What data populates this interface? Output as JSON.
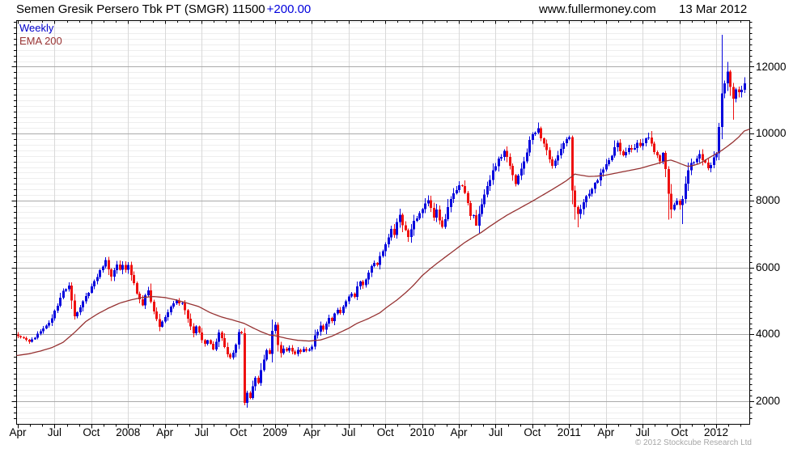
{
  "header": {
    "instrument": "Semen Gresik Persero Tbk PT (SMGR)",
    "last_price": "11500",
    "change": "+200.00",
    "website": "www.fullermoney.com",
    "date": "13 Mar 2012"
  },
  "legend": {
    "timeframe": "Weekly",
    "overlay": "EMA 200"
  },
  "footer": {
    "copyright": "© 2012 Stockcube Research Ltd"
  },
  "colors": {
    "up": "#0707dd",
    "down": "#ee1111",
    "ema": "#963232",
    "timeframe_label": "#0000cc",
    "overlay_label": "#993333",
    "change_text": "#0000dd",
    "grid_minor": "#eeeeee",
    "grid_vertical": "#d9d9d9",
    "grid_major": "#aaaaaa",
    "axis": "#000000",
    "copyright_text": "#a6a6a6"
  },
  "y_axis": {
    "ticks": [
      2000,
      4000,
      6000,
      8000,
      10000,
      12000
    ]
  },
  "x_axis": {
    "ticks": [
      "Apr",
      "Jul",
      "Oct",
      "2008",
      "Apr",
      "Jul",
      "Oct",
      "2009",
      "Apr",
      "Jul",
      "Oct",
      "2010",
      "Apr",
      "Jul",
      "Oct",
      "2011",
      "Apr",
      "Jul",
      "Oct",
      "2012"
    ]
  },
  "chart_data": {
    "type": "candlestick",
    "title": "Semen Gresik Persero Tbk PT (SMGR) weekly candlestick chart with 200-period EMA",
    "x_range": "Apr 2007 - Mar 2012",
    "x_unit": "week",
    "weeks": 258,
    "ylim_visible": [
      1320,
      13400
    ],
    "grid": "on",
    "up_rule": "close >= open",
    "close_anchors": [
      [
        0,
        3950
      ],
      [
        2,
        3870
      ],
      [
        4,
        3800
      ],
      [
        6,
        3900
      ],
      [
        8,
        4100
      ],
      [
        10,
        4250
      ],
      [
        12,
        4500
      ],
      [
        14,
        4850
      ],
      [
        16,
        5300
      ],
      [
        18,
        5450
      ],
      [
        19,
        5000
      ],
      [
        20,
        4500
      ],
      [
        21,
        4650
      ],
      [
        23,
        5000
      ],
      [
        25,
        5250
      ],
      [
        26,
        5450
      ],
      [
        28,
        5750
      ],
      [
        30,
        6050
      ],
      [
        31,
        6200
      ],
      [
        32,
        5950
      ],
      [
        33,
        5750
      ],
      [
        34,
        5950
      ],
      [
        35,
        6100
      ],
      [
        36,
        5900
      ],
      [
        37,
        6050
      ],
      [
        38,
        5950
      ],
      [
        39,
        6050
      ],
      [
        40,
        5800
      ],
      [
        41,
        5550
      ],
      [
        42,
        5250
      ],
      [
        44,
        4850
      ],
      [
        45,
        5150
      ],
      [
        46,
        5300
      ],
      [
        47,
        5000
      ],
      [
        48,
        4700
      ],
      [
        49,
        4450
      ],
      [
        50,
        4250
      ],
      [
        52,
        4550
      ],
      [
        54,
        4800
      ],
      [
        56,
        5000
      ],
      [
        58,
        4900
      ],
      [
        59,
        4700
      ],
      [
        60,
        4450
      ],
      [
        61,
        4250
      ],
      [
        62,
        4050
      ],
      [
        63,
        4250
      ],
      [
        64,
        4050
      ],
      [
        65,
        3850
      ],
      [
        66,
        3700
      ],
      [
        67,
        3850
      ],
      [
        68,
        3700
      ],
      [
        69,
        3550
      ],
      [
        70,
        3800
      ],
      [
        71,
        4050
      ],
      [
        72,
        3900
      ],
      [
        73,
        3600
      ],
      [
        74,
        3400
      ],
      [
        75,
        3300
      ],
      [
        76,
        3450
      ],
      [
        77,
        3700
      ],
      [
        78,
        4050
      ],
      [
        79,
        4000
      ],
      [
        80,
        1950
      ],
      [
        81,
        2250
      ],
      [
        82,
        2100
      ],
      [
        83,
        2450
      ],
      [
        84,
        2700
      ],
      [
        85,
        2550
      ],
      [
        86,
        2950
      ],
      [
        87,
        3250
      ],
      [
        88,
        3500
      ],
      [
        89,
        3400
      ],
      [
        90,
        4100
      ],
      [
        91,
        4280
      ],
      [
        92,
        3650
      ],
      [
        93,
        3420
      ],
      [
        94,
        3550
      ],
      [
        95,
        3500
      ],
      [
        96,
        3600
      ],
      [
        97,
        3480
      ],
      [
        98,
        3420
      ],
      [
        99,
        3550
      ],
      [
        100,
        3500
      ],
      [
        101,
        3580
      ],
      [
        102,
        3500
      ],
      [
        103,
        3550
      ],
      [
        104,
        3650
      ],
      [
        105,
        3950
      ],
      [
        106,
        4100
      ],
      [
        107,
        4300
      ],
      [
        108,
        4150
      ],
      [
        109,
        4300
      ],
      [
        110,
        4500
      ],
      [
        111,
        4400
      ],
      [
        112,
        4600
      ],
      [
        113,
        4750
      ],
      [
        114,
        4650
      ],
      [
        115,
        4850
      ],
      [
        116,
        4950
      ],
      [
        117,
        5100
      ],
      [
        118,
        5250
      ],
      [
        119,
        5150
      ],
      [
        120,
        5400
      ],
      [
        121,
        5600
      ],
      [
        122,
        5450
      ],
      [
        123,
        5650
      ],
      [
        124,
        5850
      ],
      [
        125,
        6000
      ],
      [
        126,
        6150
      ],
      [
        127,
        6050
      ],
      [
        128,
        6300
      ],
      [
        129,
        6450
      ],
      [
        130,
        6700
      ],
      [
        131,
        6900
      ],
      [
        132,
        7100
      ],
      [
        133,
        6950
      ],
      [
        134,
        7300
      ],
      [
        135,
        7550
      ],
      [
        136,
        7300
      ],
      [
        137,
        7100
      ],
      [
        138,
        6950
      ],
      [
        139,
        7150
      ],
      [
        140,
        7350
      ],
      [
        141,
        7500
      ],
      [
        142,
        7650
      ],
      [
        143,
        7800
      ],
      [
        144,
        7950
      ],
      [
        145,
        8050
      ],
      [
        146,
        7800
      ],
      [
        147,
        7550
      ],
      [
        148,
        7750
      ],
      [
        149,
        7400
      ],
      [
        150,
        7200
      ],
      [
        151,
        7500
      ],
      [
        152,
        7800
      ],
      [
        153,
        8000
      ],
      [
        154,
        8200
      ],
      [
        155,
        8350
      ],
      [
        156,
        8500
      ],
      [
        157,
        8400
      ],
      [
        158,
        8250
      ],
      [
        159,
        7900
      ],
      [
        160,
        7600
      ],
      [
        161,
        7500
      ],
      [
        162,
        7300
      ],
      [
        163,
        7600
      ],
      [
        164,
        7900
      ],
      [
        165,
        8200
      ],
      [
        166,
        8450
      ],
      [
        167,
        8650
      ],
      [
        168,
        8850
      ],
      [
        169,
        9000
      ],
      [
        170,
        9200
      ],
      [
        171,
        9350
      ],
      [
        172,
        9500
      ],
      [
        173,
        9300
      ],
      [
        174,
        9000
      ],
      [
        175,
        8750
      ],
      [
        176,
        8550
      ],
      [
        177,
        8700
      ],
      [
        178,
        8900
      ],
      [
        179,
        9200
      ],
      [
        180,
        9500
      ],
      [
        181,
        9750
      ],
      [
        182,
        9900
      ],
      [
        183,
        10050
      ],
      [
        184,
        10200
      ],
      [
        185,
        9900
      ],
      [
        186,
        9700
      ],
      [
        187,
        9500
      ],
      [
        188,
        9300
      ],
      [
        189,
        9100
      ],
      [
        190,
        9250
      ],
      [
        191,
        9400
      ],
      [
        192,
        9550
      ],
      [
        193,
        9700
      ],
      [
        194,
        9800
      ],
      [
        195,
        9900
      ],
      [
        196,
        8300
      ],
      [
        197,
        7800
      ],
      [
        198,
        7600
      ],
      [
        199,
        7800
      ],
      [
        200,
        7950
      ],
      [
        201,
        8100
      ],
      [
        202,
        8200
      ],
      [
        203,
        8350
      ],
      [
        204,
        8500
      ],
      [
        205,
        8650
      ],
      [
        206,
        8800
      ],
      [
        207,
        8900
      ],
      [
        208,
        9050
      ],
      [
        209,
        9250
      ],
      [
        210,
        9400
      ],
      [
        211,
        9550
      ],
      [
        212,
        9650
      ],
      [
        213,
        9450
      ],
      [
        214,
        9350
      ],
      [
        215,
        9500
      ],
      [
        216,
        9600
      ],
      [
        217,
        9450
      ],
      [
        218,
        9550
      ],
      [
        219,
        9650
      ],
      [
        220,
        9600
      ],
      [
        221,
        9700
      ],
      [
        222,
        9800
      ],
      [
        223,
        9900
      ],
      [
        224,
        9750
      ],
      [
        225,
        9500
      ],
      [
        226,
        9350
      ],
      [
        227,
        9200
      ],
      [
        228,
        9350
      ],
      [
        229,
        9000
      ],
      [
        230,
        8200
      ],
      [
        231,
        7700
      ],
      [
        232,
        7900
      ],
      [
        233,
        8050
      ],
      [
        234,
        7800
      ],
      [
        235,
        8000
      ],
      [
        236,
        8450
      ],
      [
        237,
        8950
      ],
      [
        238,
        9100
      ],
      [
        239,
        9200
      ],
      [
        240,
        9300
      ],
      [
        241,
        9350
      ],
      [
        242,
        9200
      ],
      [
        243,
        9100
      ],
      [
        244,
        8950
      ],
      [
        245,
        9100
      ],
      [
        246,
        9250
      ],
      [
        247,
        9400
      ],
      [
        248,
        10200
      ],
      [
        249,
        11200
      ],
      [
        250,
        11500
      ],
      [
        251,
        11850
      ],
      [
        252,
        11400
      ],
      [
        253,
        11050
      ],
      [
        254,
        11300
      ],
      [
        255,
        11150
      ],
      [
        256,
        11300
      ],
      [
        257,
        11500
      ]
    ],
    "wick_overrides": [
      [
        18,
        5560,
        0
      ],
      [
        31,
        6310,
        0
      ],
      [
        80,
        0,
        1880
      ],
      [
        135,
        7750,
        0
      ],
      [
        145,
        8150,
        0
      ],
      [
        162,
        0,
        7250
      ],
      [
        173,
        9620,
        0
      ],
      [
        184,
        10330,
        0
      ],
      [
        196,
        9950,
        0
      ],
      [
        197,
        0,
        7430
      ],
      [
        198,
        0,
        7200
      ],
      [
        223,
        10030,
        0
      ],
      [
        230,
        0,
        7430
      ],
      [
        235,
        0,
        7300
      ],
      [
        249,
        12950,
        0
      ],
      [
        251,
        12150,
        0
      ],
      [
        253,
        0,
        10420
      ]
    ],
    "ema200_anchors": [
      [
        0,
        3370
      ],
      [
        4,
        3420
      ],
      [
        8,
        3500
      ],
      [
        12,
        3600
      ],
      [
        16,
        3760
      ],
      [
        20,
        4050
      ],
      [
        24,
        4380
      ],
      [
        28,
        4600
      ],
      [
        32,
        4780
      ],
      [
        36,
        4930
      ],
      [
        40,
        5030
      ],
      [
        44,
        5100
      ],
      [
        48,
        5130
      ],
      [
        52,
        5100
      ],
      [
        56,
        5030
      ],
      [
        60,
        4930
      ],
      [
        64,
        4830
      ],
      [
        68,
        4650
      ],
      [
        72,
        4520
      ],
      [
        76,
        4430
      ],
      [
        80,
        4330
      ],
      [
        83,
        4200
      ],
      [
        86,
        4080
      ],
      [
        89,
        3980
      ],
      [
        91,
        3960
      ],
      [
        95,
        3880
      ],
      [
        99,
        3820
      ],
      [
        103,
        3800
      ],
      [
        107,
        3830
      ],
      [
        111,
        3940
      ],
      [
        114,
        4060
      ],
      [
        117,
        4180
      ],
      [
        120,
        4330
      ],
      [
        124,
        4470
      ],
      [
        128,
        4640
      ],
      [
        131,
        4840
      ],
      [
        134,
        5020
      ],
      [
        137,
        5230
      ],
      [
        140,
        5470
      ],
      [
        143,
        5750
      ],
      [
        146,
        5970
      ],
      [
        149,
        6170
      ],
      [
        152,
        6360
      ],
      [
        155,
        6550
      ],
      [
        158,
        6740
      ],
      [
        161,
        6900
      ],
      [
        164,
        7050
      ],
      [
        167,
        7230
      ],
      [
        170,
        7400
      ],
      [
        173,
        7560
      ],
      [
        176,
        7700
      ],
      [
        179,
        7840
      ],
      [
        182,
        7980
      ],
      [
        185,
        8130
      ],
      [
        188,
        8280
      ],
      [
        191,
        8430
      ],
      [
        194,
        8590
      ],
      [
        197,
        8790
      ],
      [
        199,
        8760
      ],
      [
        202,
        8720
      ],
      [
        205,
        8730
      ],
      [
        208,
        8760
      ],
      [
        211,
        8810
      ],
      [
        214,
        8860
      ],
      [
        217,
        8910
      ],
      [
        220,
        8960
      ],
      [
        223,
        9030
      ],
      [
        226,
        9100
      ],
      [
        229,
        9180
      ],
      [
        231,
        9210
      ],
      [
        233,
        9150
      ],
      [
        235,
        9080
      ],
      [
        237,
        9020
      ],
      [
        239,
        9050
      ],
      [
        241,
        9100
      ],
      [
        243,
        9200
      ],
      [
        245,
        9300
      ],
      [
        247,
        9400
      ],
      [
        249,
        9500
      ],
      [
        251,
        9620
      ],
      [
        253,
        9750
      ],
      [
        255,
        9900
      ],
      [
        257,
        10080
      ]
    ]
  }
}
